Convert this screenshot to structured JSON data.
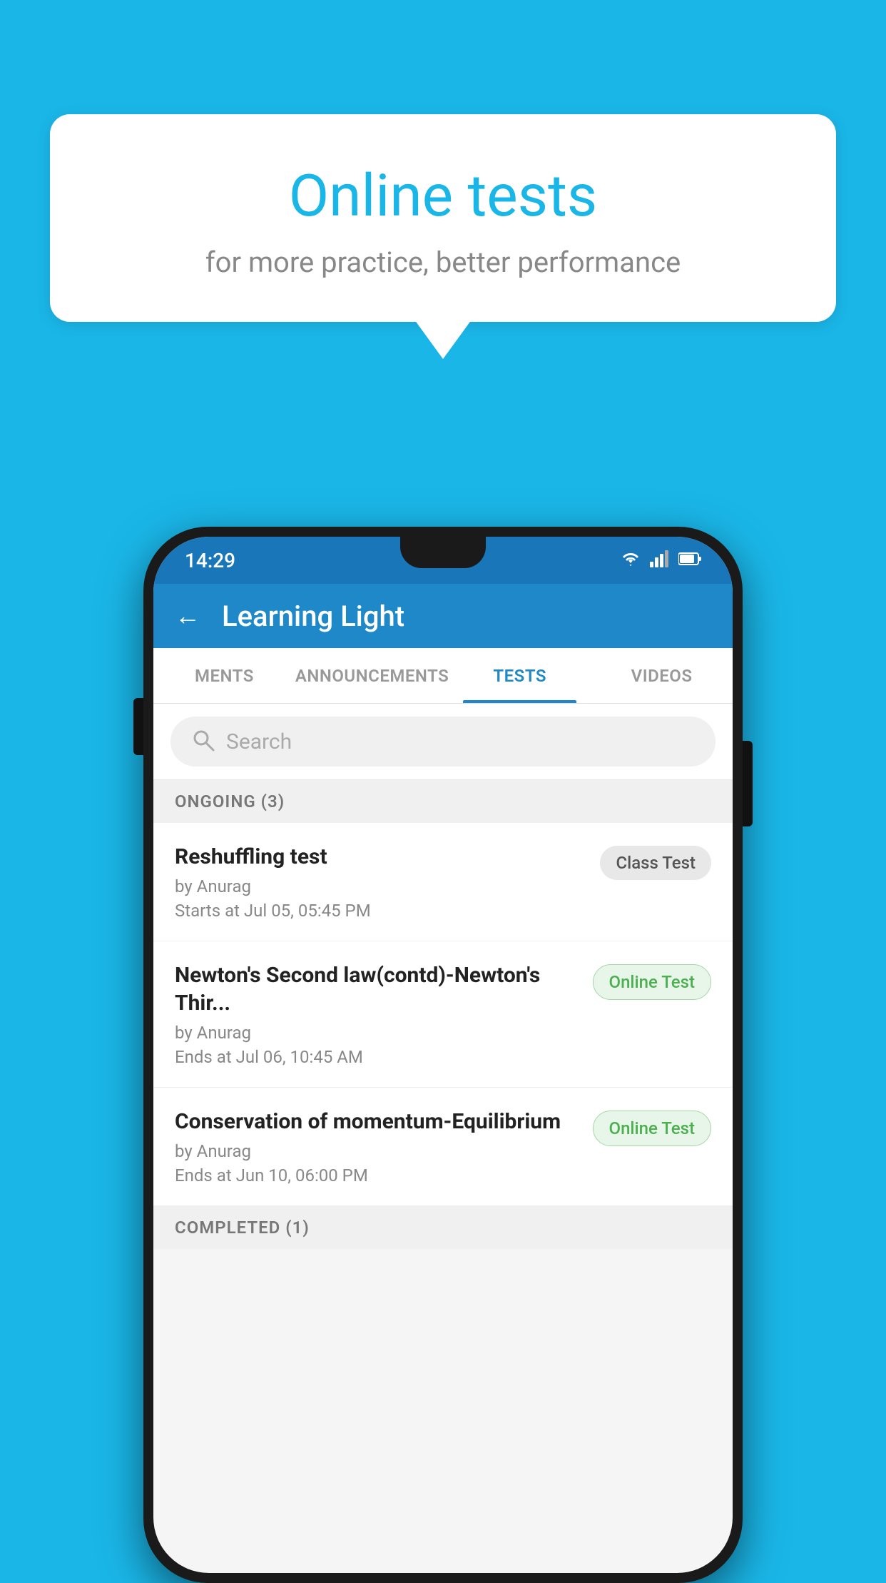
{
  "background_color": "#1ab6e8",
  "bubble": {
    "title": "Online tests",
    "subtitle": "for more practice, better performance"
  },
  "phone": {
    "status_bar": {
      "time": "14:29",
      "icons": [
        "wifi",
        "signal",
        "battery"
      ]
    },
    "app_bar": {
      "back_label": "←",
      "title": "Learning Light"
    },
    "tabs": [
      {
        "label": "MENTS",
        "active": false
      },
      {
        "label": "ANNOUNCEMENTS",
        "active": false
      },
      {
        "label": "TESTS",
        "active": true
      },
      {
        "label": "VIDEOS",
        "active": false
      }
    ],
    "search": {
      "placeholder": "Search"
    },
    "ongoing_section": {
      "label": "ONGOING (3)",
      "tests": [
        {
          "title": "Reshuffling test",
          "by": "by Anurag",
          "date": "Starts at  Jul 05, 05:45 PM",
          "badge": "Class Test",
          "badge_type": "class"
        },
        {
          "title": "Newton's Second law(contd)-Newton's Thir...",
          "by": "by Anurag",
          "date": "Ends at  Jul 06, 10:45 AM",
          "badge": "Online Test",
          "badge_type": "online"
        },
        {
          "title": "Conservation of momentum-Equilibrium",
          "by": "by Anurag",
          "date": "Ends at  Jun 10, 06:00 PM",
          "badge": "Online Test",
          "badge_type": "online"
        }
      ]
    },
    "completed_section": {
      "label": "COMPLETED (1)"
    }
  }
}
